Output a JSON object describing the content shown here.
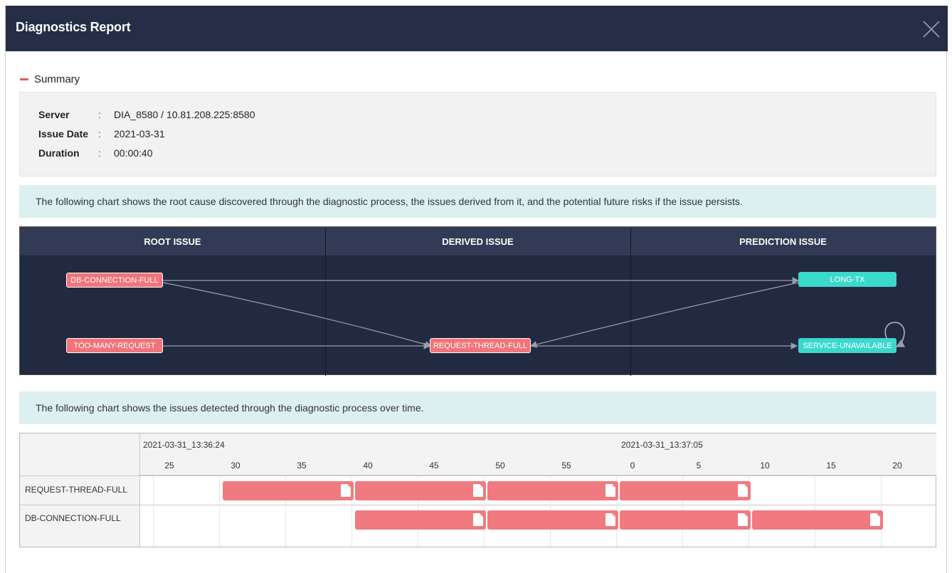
{
  "window": {
    "title": "Diagnostics Report"
  },
  "summary": {
    "heading": "Summary",
    "rows": [
      {
        "key": "Server",
        "sep": ":",
        "value": "DIA_8580 / 10.81.208.225:8580"
      },
      {
        "key": "Issue Date",
        "sep": ":",
        "value": "2021-03-31"
      },
      {
        "key": "Duration",
        "sep": ":",
        "value": "00:00:40"
      }
    ]
  },
  "info1": "The following chart shows the root cause discovered through the diagnostic process, the issues derived from it, and the potential future risks if the issue persists.",
  "info2": "The following chart shows the issues detected through the diagnostic process over time.",
  "relation_chart": {
    "columns": [
      "ROOT ISSUE",
      "DERIVED ISSUE",
      "PREDICTION ISSUE"
    ],
    "nodes": [
      {
        "id": "db",
        "label": "DB-CONNECTION-FULL",
        "kind": "root"
      },
      {
        "id": "tmr",
        "label": "TOO-MANY-REQUEST",
        "kind": "root"
      },
      {
        "id": "rtf",
        "label": "REQUEST-THREAD-FULL",
        "kind": "derived"
      },
      {
        "id": "ltx",
        "label": "LONG-TX",
        "kind": "prediction"
      },
      {
        "id": "su",
        "label": "SERVICE-UNAVAILABLE",
        "kind": "prediction"
      }
    ],
    "edges": [
      [
        "db",
        "ltx"
      ],
      [
        "db",
        "rtf"
      ],
      [
        "tmr",
        "rtf"
      ],
      [
        "ltx",
        "rtf"
      ],
      [
        "rtf",
        "su"
      ],
      [
        "su",
        "su"
      ]
    ],
    "colors": {
      "root": "#f07479",
      "derived": "#f07479",
      "prediction": "#3bd9cc",
      "background": "#222a42",
      "header": "#323a55"
    }
  },
  "timeline": {
    "date_labels": [
      "2021-03-31_13:36:24",
      "2021-03-31_13:37:05"
    ],
    "ticks": [
      "25",
      "30",
      "35",
      "40",
      "45",
      "50",
      "55",
      "0",
      "5",
      "10",
      "15",
      "20"
    ],
    "rows": [
      {
        "label": "REQUEST-THREAD-FULL",
        "segments": [
          [
            29,
            39
          ],
          [
            39,
            49
          ],
          [
            49,
            59
          ],
          [
            59,
            69
          ]
        ]
      },
      {
        "label": "DB-CONNECTION-FULL",
        "segments": [
          [
            39,
            49
          ],
          [
            49,
            59
          ],
          [
            59,
            69
          ],
          [
            69,
            79
          ]
        ]
      }
    ],
    "color": "#f07a7f"
  }
}
